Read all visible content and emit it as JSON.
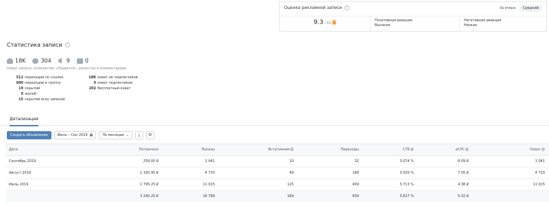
{
  "rating": {
    "title": "Оценка рекламной записи",
    "period_options": [
      "За вчера",
      "Средний"
    ],
    "score": "9.3",
    "score_scale": "/ 10",
    "positive_label": "Позитивная реакция",
    "positive_value": "Высокая",
    "negative_label": "Негативная реакция",
    "negative_value": "Низкая"
  },
  "stats": {
    "title": "Статистика записи",
    "counters": {
      "reach": "18K",
      "likes": "304",
      "reposts": "9",
      "comments": "0"
    },
    "description": "Охват записи, количество «Нравится», репостов и комментариев.",
    "left_column": [
      {
        "value": "512",
        "label": "переходов по ссылке"
      },
      {
        "value": "680",
        "label": "переходов в группу"
      },
      {
        "value": "19",
        "label": "скрытий"
      },
      {
        "value": "0",
        "label": "жалоб"
      },
      {
        "value": "15",
        "label": "скрытий всех записей"
      }
    ],
    "right_column": [
      {
        "value": "18K",
        "label": "охват не подписчиков"
      },
      {
        "value": "0",
        "label": "охват подписчиков"
      },
      {
        "value": "202",
        "label": "бесплатный охват"
      }
    ]
  },
  "tabs": [
    "Детализация"
  ],
  "toolbar": {
    "create_label": "Создать объявление",
    "date_range": "Июль – Сен 2019",
    "grouping": "По месяцам"
  },
  "table": {
    "headers": [
      "Дата",
      "Потрачено",
      "Показы",
      "Вступления",
      "Переходы",
      "CTR",
      "eCPC",
      "Охват"
    ],
    "rows": [
      [
        "Сентябрь 2019",
        "259.00 ₽",
        "1 041",
        "10",
        "32",
        "3.074 %",
        "8.09 ₽",
        "1 041"
      ],
      [
        "Август 2019",
        "1 185.95 ₽",
        "4 733",
        "49",
        "168",
        "3.550 %",
        "7.05 ₽",
        "4 733"
      ],
      [
        "Июль 2019",
        "1 795.25 ₽",
        "11 015",
        "125",
        "409",
        "3.713 %",
        "4.38 ₽",
        "11 015"
      ]
    ],
    "total": [
      "",
      "3 240.20 ₽",
      "16 789",
      "184",
      "609",
      "3.627 %",
      "5.32 ₽",
      ""
    ]
  },
  "colors": {
    "accent": "#5181b8",
    "icon_gray": "#a4adb6",
    "flame": "#f7a33c"
  }
}
